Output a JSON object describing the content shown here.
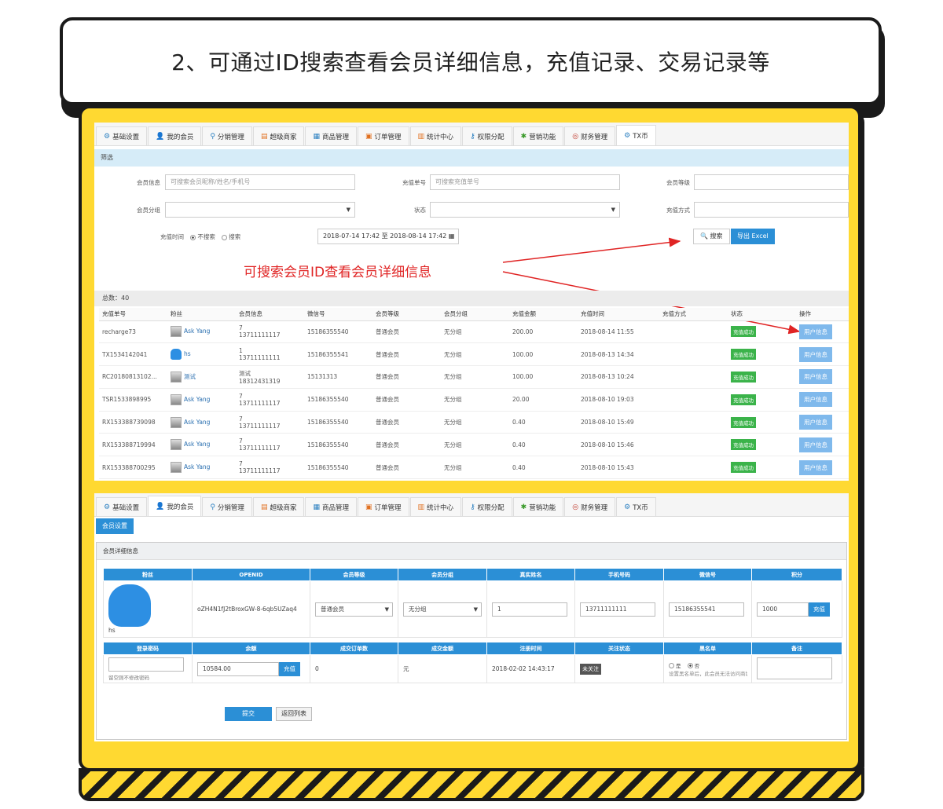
{
  "banner": {
    "title": "2、可通过ID搜索查看会员详细信息，充值记录、交易记录等"
  },
  "tabs": [
    {
      "label": "基础设置",
      "icon": "gear-icon",
      "glyph": "⚙"
    },
    {
      "label": "我的会员",
      "icon": "user-icon",
      "glyph": "👤"
    },
    {
      "label": "分销管理",
      "icon": "sitemap-icon",
      "glyph": "⚲"
    },
    {
      "label": "超级商家",
      "icon": "store-icon",
      "glyph": "▤"
    },
    {
      "label": "商品管理",
      "icon": "grid-icon",
      "glyph": "▦"
    },
    {
      "label": "订单管理",
      "icon": "order-icon",
      "glyph": "▣"
    },
    {
      "label": "统计中心",
      "icon": "chart-icon",
      "glyph": "▥"
    },
    {
      "label": "权限分配",
      "icon": "key-icon",
      "glyph": "⚷"
    },
    {
      "label": "营销功能",
      "icon": "marketing-icon",
      "glyph": "✱"
    },
    {
      "label": "财务管理",
      "icon": "finance-icon",
      "glyph": "◎"
    },
    {
      "label": "TX币",
      "icon": "coin-icon",
      "glyph": "⚙"
    }
  ],
  "filter": {
    "title": "筛选",
    "member_info_label": "会员信息",
    "member_info_placeholder": "可搜索会员昵称/姓名/手机号",
    "recharge_no_label": "充值单号",
    "recharge_no_placeholder": "可搜索充值单号",
    "member_level_label": "会员等级",
    "member_group_label": "会员分组",
    "status_label": "状态",
    "recharge_method_label": "充值方式",
    "recharge_time_label": "充值时间",
    "radio_no_search": "不搜索",
    "radio_search": "搜索",
    "date_range": "2018-07-14 17:42 至 2018-08-14 17:42",
    "search_button": "搜索",
    "export_button": "导出 Excel"
  },
  "annotation": "可搜索会员ID查看会员详细信息",
  "list": {
    "total": "总数：40",
    "columns": [
      "充值单号",
      "粉丝",
      "会员信息",
      "微信号",
      "会员等级",
      "会员分组",
      "充值金额",
      "充值时间",
      "充值方式",
      "状态",
      "操作"
    ],
    "rows": [
      {
        "no": "recharge73",
        "fan": "Ask Yang",
        "info1": "7",
        "info2": "13711111117",
        "wx": "15186355540",
        "level": "普通会员",
        "group": "无分组",
        "amount": "200.00",
        "time": "2018-08-14 11:55",
        "status": "充值成功",
        "action": "用户信息"
      },
      {
        "no": "TX1534142041",
        "fan": "hs",
        "info1": "1",
        "info2": "13711111111",
        "wx": "15186355541",
        "level": "普通会员",
        "group": "无分组",
        "amount": "100.00",
        "time": "2018-08-13 14:34",
        "status": "充值成功",
        "action": "用户信息"
      },
      {
        "no": "RC20180813102...",
        "fan": "测试",
        "info1": "测试",
        "info2": "18312431319",
        "wx": "15131313",
        "level": "普通会员",
        "group": "无分组",
        "amount": "100.00",
        "time": "2018-08-13 10:24",
        "status": "充值成功",
        "action": "用户信息"
      },
      {
        "no": "TSR1533898995",
        "fan": "Ask Yang",
        "info1": "7",
        "info2": "13711111117",
        "wx": "15186355540",
        "level": "普通会员",
        "group": "无分组",
        "amount": "20.00",
        "time": "2018-08-10 19:03",
        "status": "充值成功",
        "action": "用户信息"
      },
      {
        "no": "RX153388739098",
        "fan": "Ask Yang",
        "info1": "7",
        "info2": "13711111117",
        "wx": "15186355540",
        "level": "普通会员",
        "group": "无分组",
        "amount": "0.40",
        "time": "2018-08-10 15:49",
        "status": "充值成功",
        "action": "用户信息"
      },
      {
        "no": "RX153388719994",
        "fan": "Ask Yang",
        "info1": "7",
        "info2": "13711111117",
        "wx": "15186355540",
        "level": "普通会员",
        "group": "无分组",
        "amount": "0.40",
        "time": "2018-08-10 15:46",
        "status": "充值成功",
        "action": "用户信息"
      },
      {
        "no": "RX153388700295",
        "fan": "Ask Yang",
        "info1": "7",
        "info2": "13711111117",
        "wx": "15186355540",
        "level": "普通会员",
        "group": "无分组",
        "amount": "0.40",
        "time": "2018-08-10 15:43",
        "status": "充值成功",
        "action": "用户信息"
      }
    ]
  },
  "detail": {
    "subtab": "会员设置",
    "panel_title": "会员详细信息",
    "head1": [
      "粉丝",
      "OPENID",
      "会员等级",
      "会员分组",
      "真实姓名",
      "手机号码",
      "微信号",
      "积分"
    ],
    "fan_name": "hs",
    "openid": "oZH4N1fJ2tBroxGW-8-6qb5UZaq4",
    "level": "普通会员",
    "group": "无分组",
    "real_name": "1",
    "mobile": "13711111111",
    "wechat": "15186355541",
    "points": "1000",
    "points_btn": "充值",
    "head2": [
      "登录密码",
      "余额",
      "成交订单数",
      "成交金额",
      "注册时间",
      "关注状态",
      "黑名单",
      "备注"
    ],
    "password_hint": "留空则不修改密码",
    "balance": "10584.00",
    "balance_btn": "充值",
    "orders": "0",
    "order_amount": "元",
    "reg_time": "2018-02-02 14:43:17",
    "follow": "未关注",
    "blacklist_yes": "是",
    "blacklist_no": "否",
    "blacklist_hint": "设置黑名单后，此会员无法访问商城",
    "submit": "提交",
    "back": "返回列表"
  },
  "colors": {
    "accent": "#2b8fd6",
    "frame": "#ffd931",
    "success": "#3bb34a",
    "annotation": "#e02424"
  }
}
